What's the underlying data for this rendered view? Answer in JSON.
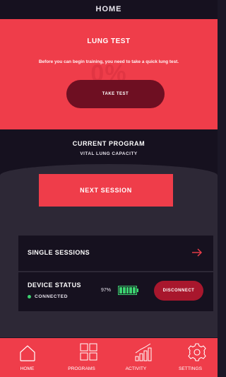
{
  "header": {
    "title": "HOME"
  },
  "lung_test": {
    "title": "LUNG TEST",
    "description": "Before you can begin training, you need to take a quick lung test.",
    "background_value": "0%",
    "button_label": "TAKE TEST"
  },
  "program": {
    "title": "CURRENT PROGRAM",
    "name": "VITAL LUNG CAPACITY",
    "next_button": "NEXT SESSION"
  },
  "single_sessions": {
    "label": "SINGLE SESSIONS",
    "icon": "arrow-right-icon"
  },
  "device": {
    "title": "DEVICE STATUS",
    "status": "CONNECTED",
    "battery_percent": "97%",
    "battery_level": 0.97,
    "disconnect_label": "DISCONNECT"
  },
  "nav": {
    "items": [
      {
        "label": "HOME",
        "icon": "home-icon"
      },
      {
        "label": "PROGRAMS",
        "icon": "programs-grid-icon"
      },
      {
        "label": "ACTIVITY",
        "icon": "activity-chart-icon"
      },
      {
        "label": "SETTINGS",
        "icon": "gear-icon"
      }
    ]
  },
  "colors": {
    "accent": "#ef3d4a",
    "dark": "#16111f",
    "panel": "#2d2836",
    "button_dark": "#6e0f22",
    "connected": "#3bd16f"
  }
}
